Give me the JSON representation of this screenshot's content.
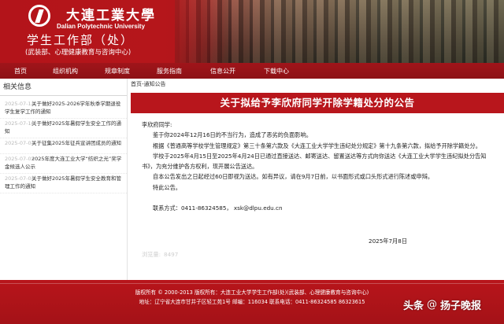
{
  "header": {
    "school_cn": "大連工業大學",
    "school_en": "Dalian Polytechnic University",
    "dept_title": "学生工作部（处）",
    "dept_sub": "(武装部、心理健康教育与咨询中心)"
  },
  "nav": {
    "items": [
      {
        "label": "首页"
      },
      {
        "label": "组织机构"
      },
      {
        "label": "规章制度"
      },
      {
        "label": "服务指南"
      },
      {
        "label": "信息公开"
      },
      {
        "label": "下载中心"
      }
    ]
  },
  "sidebar": {
    "heading": "相关信息",
    "items": [
      {
        "date": "2025-07-11",
        "text": "关于做好2025-2026学年秋季学期退役学生复学工作的通知"
      },
      {
        "date": "2025-07-10",
        "text": "关于做好2025年暑假学生安全工作的通知"
      },
      {
        "date": "2025-07-07",
        "text": "关于征集2025年征兵宣讲团成员的通知"
      },
      {
        "date": "2025-07-0?",
        "text": "2025年度大连工业大学“纺织之光”奖学金候选人公示"
      },
      {
        "date": "2025-07-0?",
        "text": "关于做好2025年暑假学生安全教育和管理工作的通知"
      }
    ]
  },
  "main": {
    "breadcrumb": {
      "home": "首页",
      "sep": "-",
      "section": "通知公告"
    },
    "title": "关于拟给予李欣府同学开除学籍处分的公告",
    "salutation": "李欣府同学:",
    "paragraphs": [
      "鉴于你2024年12月16日的不当行为，造成了恶劣的负面影响。",
      "根据《普通高等学校学生管理规定》第三十条第六款及《大连工业大学学生违纪处分规定》第十九条第六款，拟给予开除学籍处分。",
      "学校于2025年4月15日至2025年4月24日已通过直接送达、邮寄送达、留置送达等方式向你送达《大连工业大学学生违纪拟处分告知书》，为充分维护各方权利，现开展公告送达。",
      "自本公告发出之日起经过60日即视为送达。如有异议，请在9月7日前，以书面形式或口头形式进行陈述或申辩。",
      "特此公告。"
    ],
    "contact": "联系方式：0411-86324585，  xsk@dlpu.edu.cn",
    "date": "2025年7月8日",
    "views_label": "浏览量:",
    "views_count": "8497"
  },
  "footer": {
    "line1": "版权所有 © 2000-2013 版权所有：大连工业大学学生工作部(处)(武装部、心理健康教育与咨询中心)",
    "line2": "地址：辽宁省大连市甘井子区轻工苑1号  邮编：116034 联系电话：0411-86324585 86323615"
  },
  "watermark": {
    "brand": "头条",
    "sep": "@",
    "account": "扬子晚报"
  },
  "colors": {
    "brand_red": "#b8161c",
    "nav_red": "#9c1419",
    "footer_red": "#b8151b"
  }
}
